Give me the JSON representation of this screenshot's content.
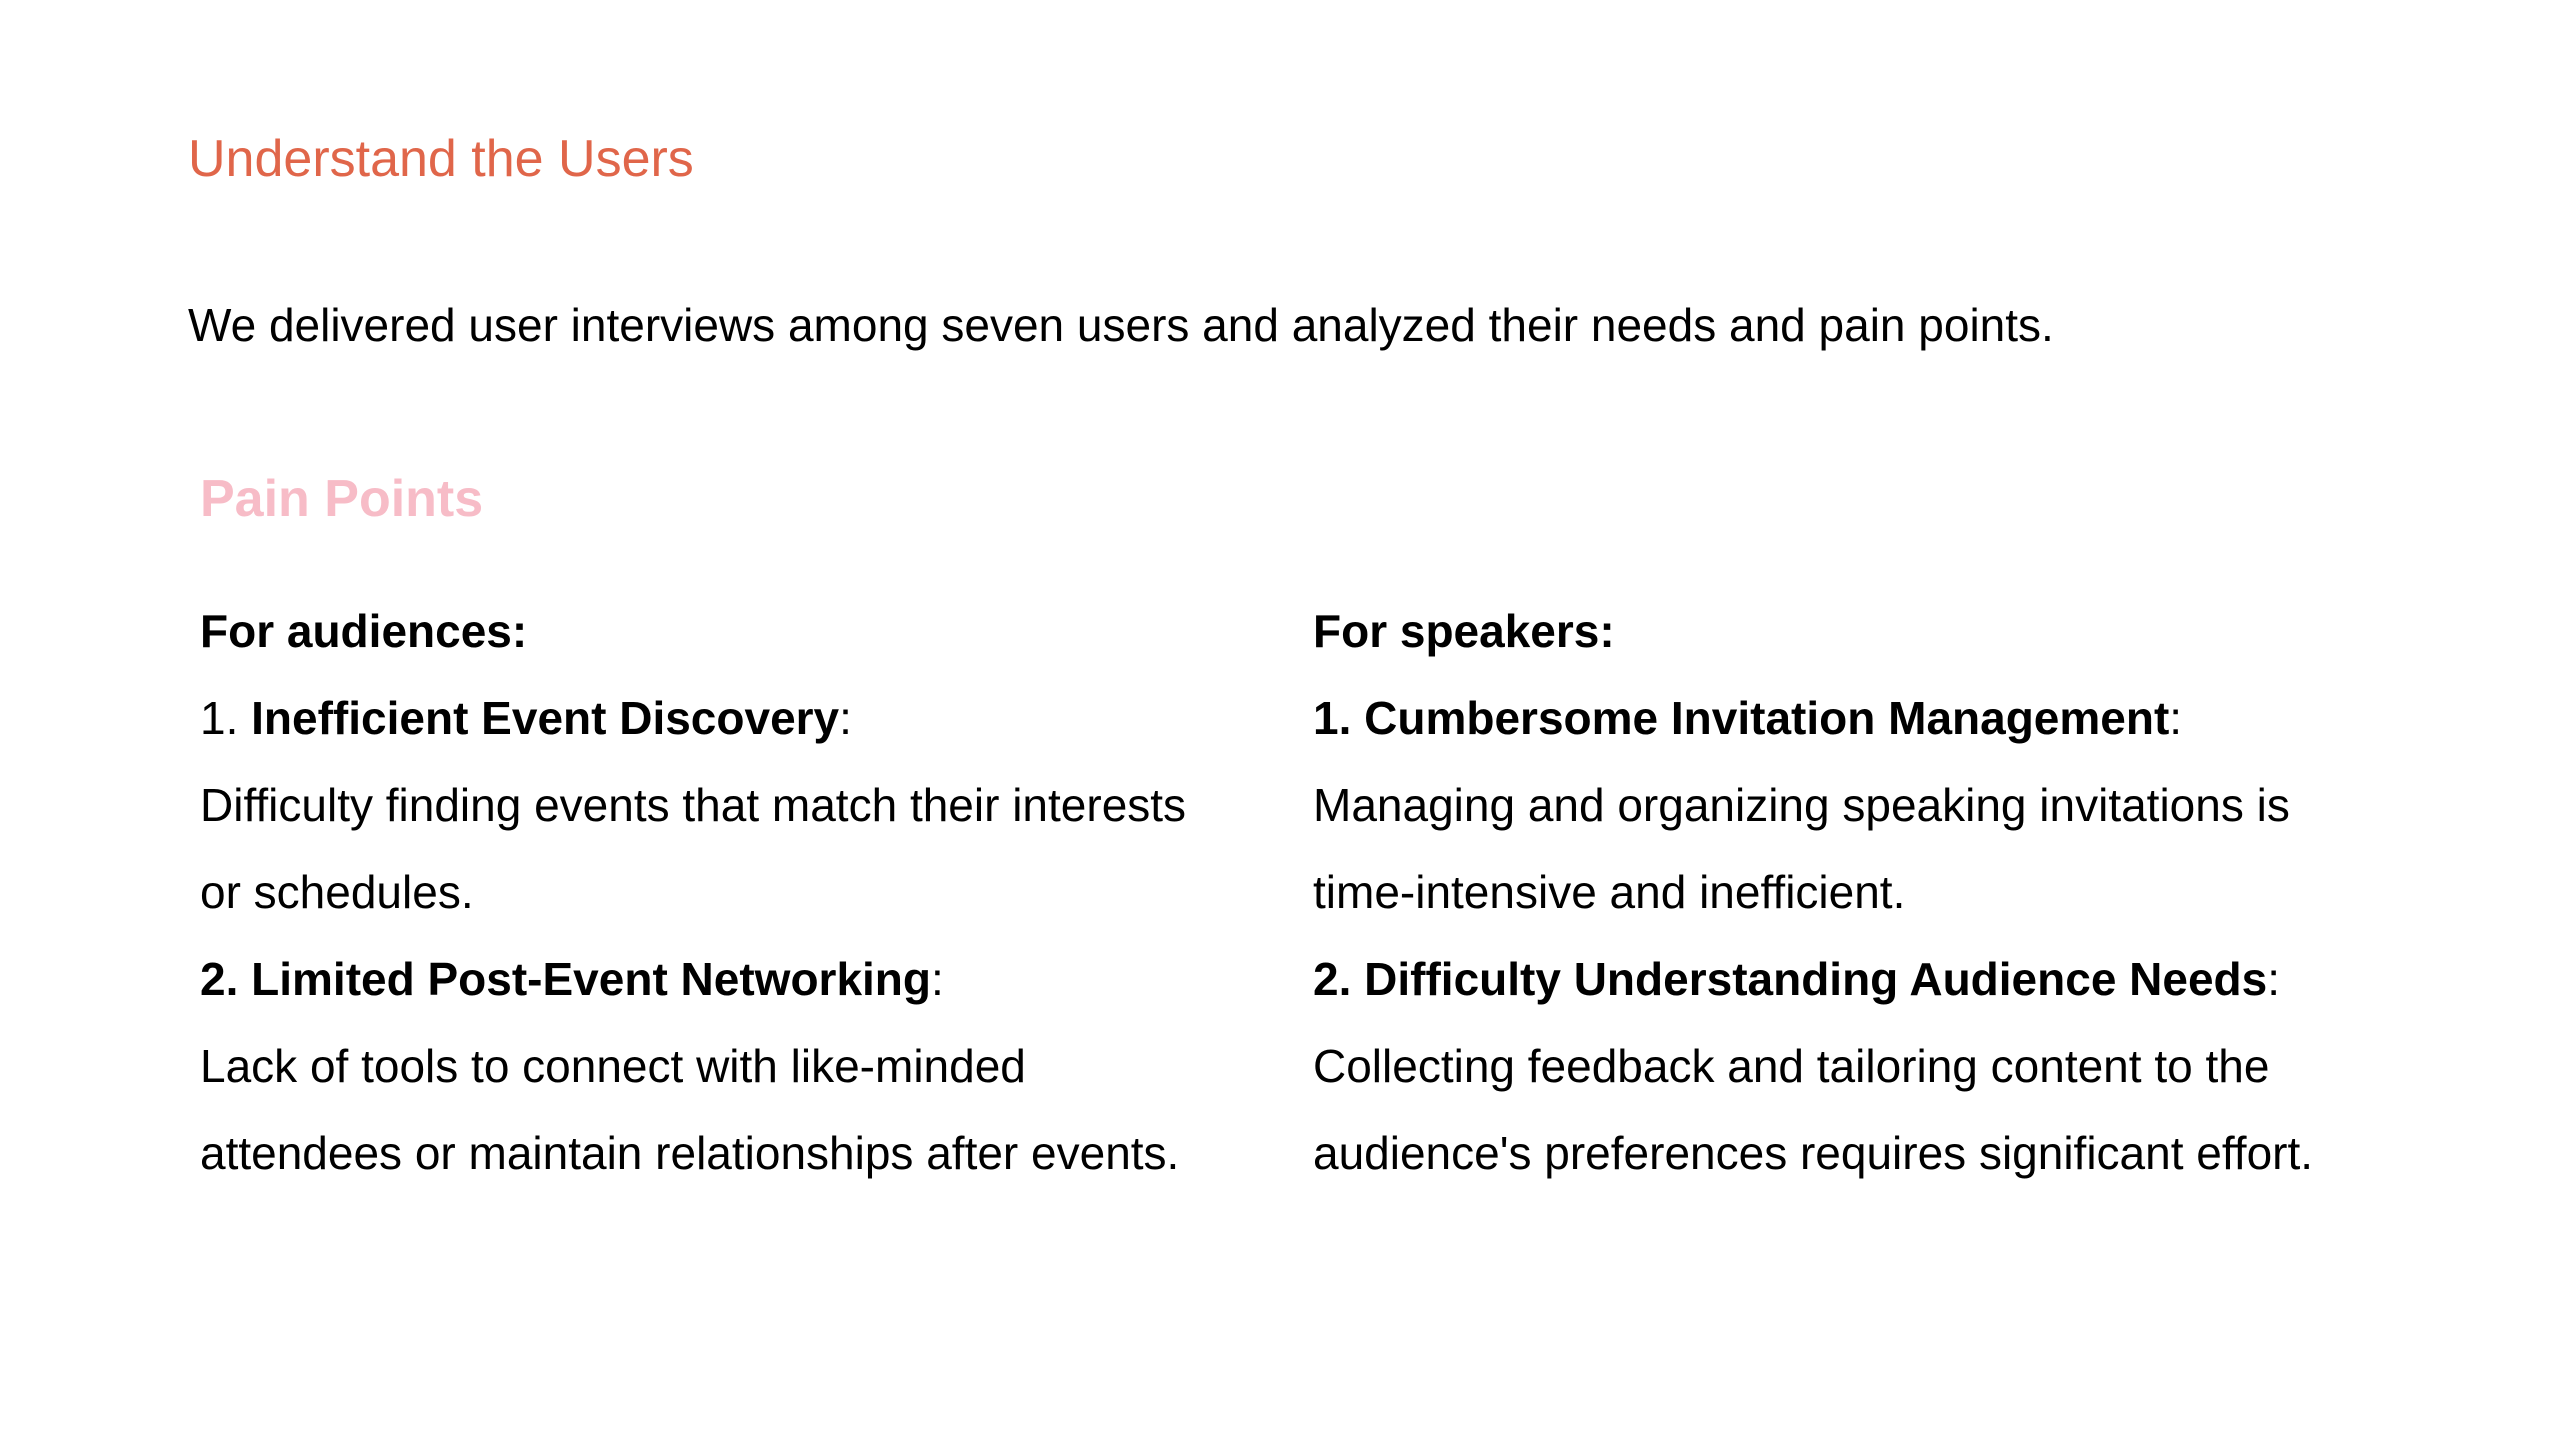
{
  "colors": {
    "title": "#e0664a",
    "subheading": "#f7bcc7",
    "text": "#000000"
  },
  "page": {
    "section_title": "Understand the Users",
    "intro": "We delivered user interviews among seven users and analyzed their needs and pain points.",
    "subheading": "Pain Points"
  },
  "audiences": {
    "heading": "For audiences:",
    "items": [
      {
        "number_prefix": "1. ",
        "title": "Inefficient Event Discovery",
        "suffix": ":",
        "description_lines": [
          "Difficulty finding events that match their interests",
          "or schedules."
        ]
      },
      {
        "number_prefix": "2. ",
        "title": "Limited Post-Event Networking",
        "suffix": ":",
        "description_lines": [
          "Lack of tools to connect with like-minded",
          "attendees or maintain relationships after events."
        ]
      }
    ]
  },
  "speakers": {
    "heading": "For speakers:",
    "items": [
      {
        "number_prefix": "1. ",
        "title": "Cumbersome Invitation Management",
        "suffix": ":",
        "description_lines": [
          "Managing and organizing speaking invitations is",
          "time-intensive and inefficient."
        ]
      },
      {
        "number_prefix": "2. ",
        "title": "Difficulty Understanding Audience Needs",
        "suffix": ":",
        "description_lines": [
          "Collecting feedback and tailoring content to the",
          "audience's preferences requires significant effort."
        ]
      }
    ]
  }
}
